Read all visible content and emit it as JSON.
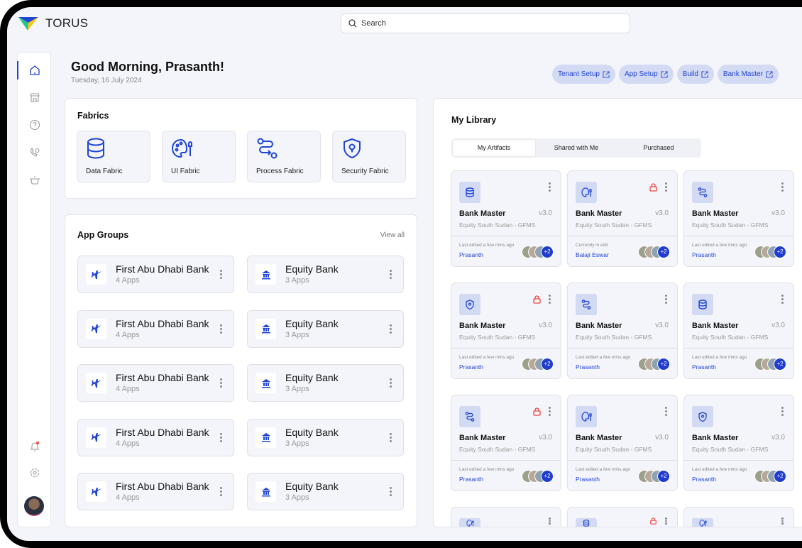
{
  "app": {
    "name": "TORUS",
    "search_placeholder": "Search"
  },
  "greeting": {
    "title": "Good Morning, Prasanth!",
    "date": "Tuesday, 16 July 2024"
  },
  "quick_links": [
    {
      "label": "Tenant Setup"
    },
    {
      "label": "App Setup"
    },
    {
      "label": "Build"
    },
    {
      "label": "Bank Master"
    }
  ],
  "sidebar": {
    "items": [
      {
        "icon": "home-icon",
        "active": true
      },
      {
        "icon": "store-icon"
      },
      {
        "icon": "help-icon"
      },
      {
        "icon": "phone-icon"
      },
      {
        "icon": "basket-icon"
      }
    ],
    "bottom": [
      {
        "icon": "bell-icon",
        "has_notification": true
      },
      {
        "icon": "gear-icon"
      },
      {
        "icon": "avatar"
      }
    ]
  },
  "fabrics": {
    "title": "Fabrics",
    "items": [
      {
        "label": "Data Fabric",
        "icon": "database-icon"
      },
      {
        "label": "UI Fabric",
        "icon": "palette-icon"
      },
      {
        "label": "Process Fabric",
        "icon": "process-icon"
      },
      {
        "label": "Security Fabric",
        "icon": "shield-icon"
      }
    ]
  },
  "app_groups": {
    "title": "App Groups",
    "view_all": "View all",
    "items": [
      {
        "name": "First Abu Dhabi Bank",
        "apps": "4 Apps",
        "icon": "plane-icon"
      },
      {
        "name": "Equity Bank",
        "apps": "3 Apps",
        "icon": "bank-icon"
      },
      {
        "name": "First Abu Dhabi Bank",
        "apps": "4 Apps",
        "icon": "plane-icon"
      },
      {
        "name": "Equity Bank",
        "apps": "3 Apps",
        "icon": "bank-icon"
      },
      {
        "name": "First Abu Dhabi Bank",
        "apps": "4 Apps",
        "icon": "plane-icon"
      },
      {
        "name": "Equity Bank",
        "apps": "3 Apps",
        "icon": "bank-icon"
      },
      {
        "name": "First Abu Dhabi Bank",
        "apps": "4 Apps",
        "icon": "plane-icon"
      },
      {
        "name": "Equity Bank",
        "apps": "3 Apps",
        "icon": "bank-icon"
      },
      {
        "name": "First Abu Dhabi Bank",
        "apps": "4 Apps",
        "icon": "plane-icon"
      },
      {
        "name": "Equity Bank",
        "apps": "3 Apps",
        "icon": "bank-icon"
      }
    ]
  },
  "library": {
    "title": "My Library",
    "tabs": [
      {
        "label": "My Artifacts",
        "active": true
      },
      {
        "label": "Shared with Me"
      },
      {
        "label": "Purchased"
      }
    ],
    "cards": [
      {
        "icon": "data",
        "locked": false,
        "title": "Bank Master",
        "version": "v3.0",
        "subtitle": "Equity South Sudan - GFMS",
        "status": "Last edited a few mins ago",
        "user": "Prasanth",
        "extra": "+2"
      },
      {
        "icon": "ui",
        "locked": true,
        "title": "Bank Master",
        "version": "v3.0",
        "subtitle": "Equity South Sudan - GFMS",
        "status": "Currently in edit",
        "user": "Balaji Eswar",
        "extra": "+2"
      },
      {
        "icon": "process",
        "locked": false,
        "title": "Bank Master",
        "version": "v3.0",
        "subtitle": "Equity South Sudan - GFMS",
        "status": "Last edited a few mins ago",
        "user": "Prasanth",
        "extra": "+2"
      },
      {
        "icon": "security",
        "locked": true,
        "title": "Bank Master",
        "version": "v3.0",
        "subtitle": "Equity South Sudan - GFMS",
        "status": "Last edited a few mins ago",
        "user": "Prasanth",
        "extra": "+2"
      },
      {
        "icon": "process",
        "locked": false,
        "title": "Bank Master",
        "version": "v3.0",
        "subtitle": "Equity South Sudan - GFMS",
        "status": "Last edited a few mins ago",
        "user": "Prasanth",
        "extra": "+2"
      },
      {
        "icon": "data",
        "locked": false,
        "title": "Bank Master",
        "version": "v3.0",
        "subtitle": "Equity South Sudan - GFMS",
        "status": "Last edited a few mins ago",
        "user": "Prasanth",
        "extra": "+2"
      },
      {
        "icon": "process",
        "locked": true,
        "title": "Bank Master",
        "version": "v3.0",
        "subtitle": "Equity South Sudan - GFMS",
        "status": "Last edited a few mins ago",
        "user": "Prasanth",
        "extra": "+2"
      },
      {
        "icon": "ui",
        "locked": false,
        "title": "Bank Master",
        "version": "v3.0",
        "subtitle": "Equity South Sudan - GFMS",
        "status": "Last edited a few mins ago",
        "user": "Prasanth",
        "extra": "+2"
      },
      {
        "icon": "security",
        "locked": false,
        "title": "Bank Master",
        "version": "v3.0",
        "subtitle": "Equity South Sudan - GFMS",
        "status": "Last edited a few mins ago",
        "user": "Prasanth",
        "extra": "+2"
      },
      {
        "icon": "ui",
        "locked": false
      },
      {
        "icon": "data",
        "locked": true
      },
      {
        "icon": "ui",
        "locked": false
      }
    ]
  },
  "colors": {
    "accent": "#1f44d6",
    "lock": "#ef4444",
    "background": "#f4f5fa"
  }
}
